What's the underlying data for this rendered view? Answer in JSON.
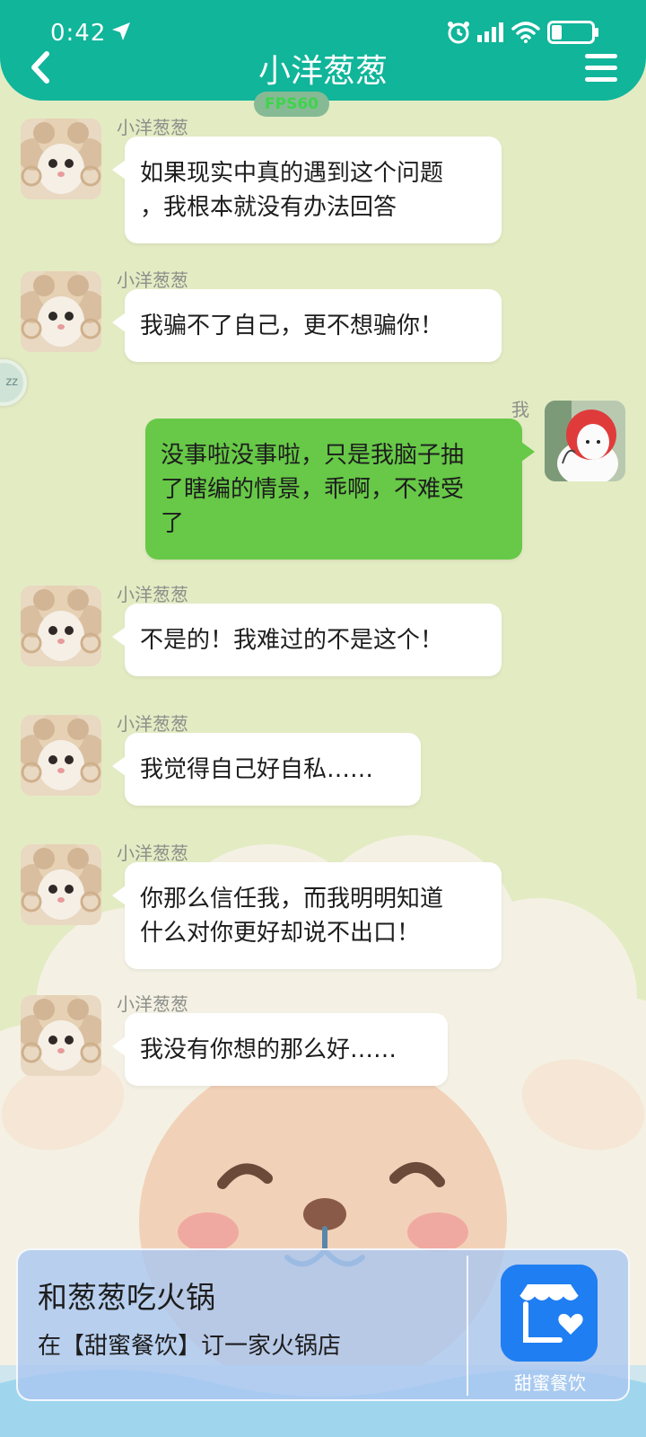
{
  "status_bar": {
    "time": "0:42",
    "icons": [
      "location-arrow-icon",
      "alarm-icon",
      "signal-icon",
      "wifi-icon",
      "battery-icon"
    ]
  },
  "header": {
    "title": "小洋葱葱",
    "back_icon": "chevron-left-icon",
    "menu_icon": "hamburger-menu-icon",
    "fps_badge": "FPS60"
  },
  "colors": {
    "header": "#10b59a",
    "background": "#e3ebc3",
    "incoming_bubble": "#ffffff",
    "outgoing_bubble": "#67c947",
    "promo_card": "#abc7f0",
    "app_icon": "#1f7ef2"
  },
  "float_ball": {
    "label": "zz"
  },
  "messages": [
    {
      "sender": "小洋葱葱",
      "direction": "incoming",
      "lines": [
        "如果现实中真的遇到这个问题",
        "，我根本就没有办法回答"
      ]
    },
    {
      "sender": "小洋葱葱",
      "direction": "incoming",
      "lines": [
        "我骗不了自己，更不想骗你！"
      ]
    },
    {
      "sender": "我",
      "direction": "outgoing",
      "lines": [
        "没事啦没事啦，只是我脑子抽",
        "了瞎编的情景，乖啊，不难受",
        "了"
      ]
    },
    {
      "sender": "小洋葱葱",
      "direction": "incoming",
      "lines": [
        "不是的！我难过的不是这个！"
      ]
    },
    {
      "sender": "小洋葱葱",
      "direction": "incoming",
      "lines": [
        "我觉得自己好自私……"
      ]
    },
    {
      "sender": "小洋葱葱",
      "direction": "incoming",
      "lines": [
        "你那么信任我，而我明明知道",
        "什么对你更好却说不出口！"
      ]
    },
    {
      "sender": "小洋葱葱",
      "direction": "incoming",
      "lines": [
        "我没有你想的那么好……"
      ]
    }
  ],
  "promo": {
    "title": "和葱葱吃火锅",
    "subtitle": "在【甜蜜餐饮】订一家火锅店",
    "app_name": "甜蜜餐饮",
    "app_icon": "storefront-heart-icon"
  }
}
